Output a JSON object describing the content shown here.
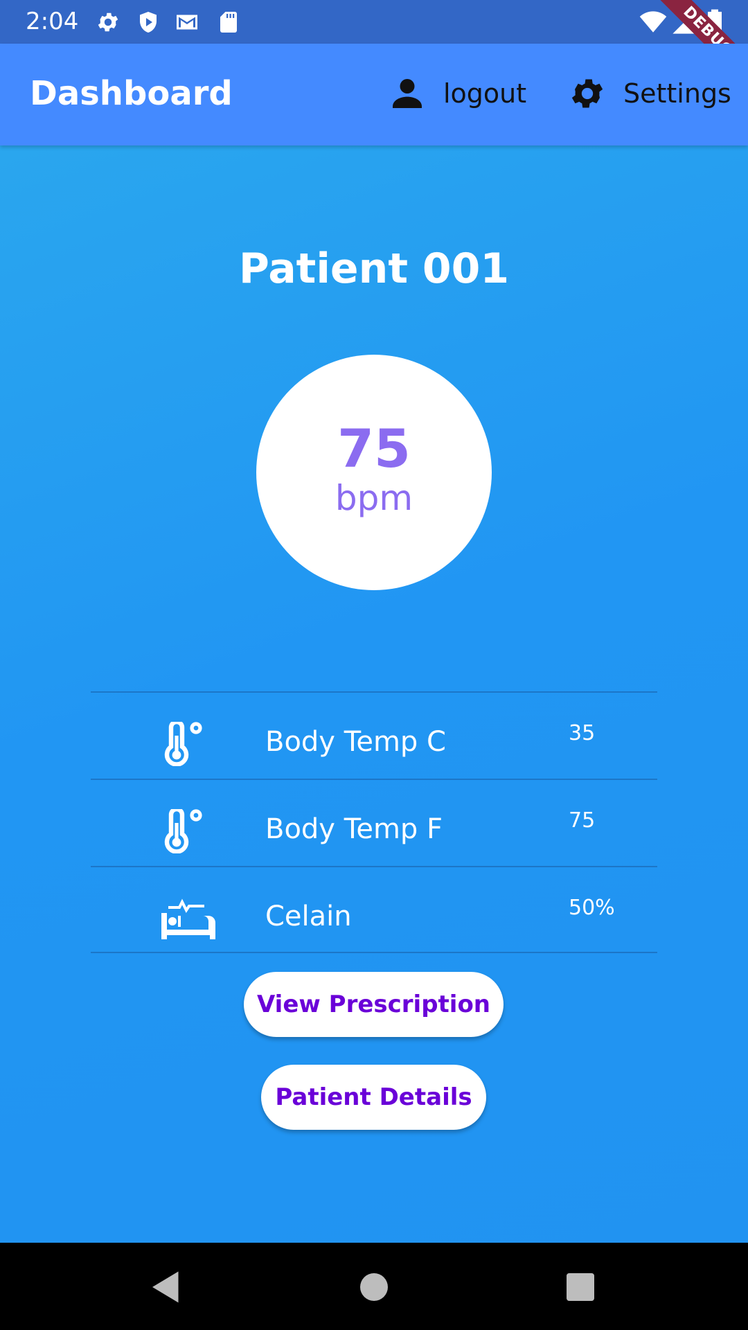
{
  "status_bar": {
    "time": "2:04",
    "debug_label": "DEBUG",
    "icons": [
      "gear-icon",
      "play-protect-icon",
      "gmail-icon",
      "sd-card-icon",
      "wifi-icon",
      "signal-icon",
      "battery-icon"
    ]
  },
  "app_bar": {
    "title": "Dashboard",
    "logout_label": "logout",
    "settings_label": "Settings",
    "color": "#448aff"
  },
  "patient": {
    "title": "Patient 001",
    "heart_rate_value": "75",
    "heart_rate_unit": "bpm"
  },
  "vitals": [
    {
      "icon": "thermometer-icon",
      "label": "Body Temp C",
      "value": "35"
    },
    {
      "icon": "thermometer-icon",
      "label": "Body Temp F",
      "value": "75"
    },
    {
      "icon": "hospital-bed-icon",
      "label": "Celain",
      "value": "50%"
    }
  ],
  "buttons": {
    "view_prescription": "View Prescription",
    "patient_details": "Patient Details"
  },
  "colors": {
    "accent_purple": "#6a00d8",
    "heart_rate": "#8b6cf0",
    "background": "#2196f3"
  },
  "nav_bar": {
    "icons": [
      "back-icon",
      "home-icon",
      "recents-icon"
    ]
  }
}
